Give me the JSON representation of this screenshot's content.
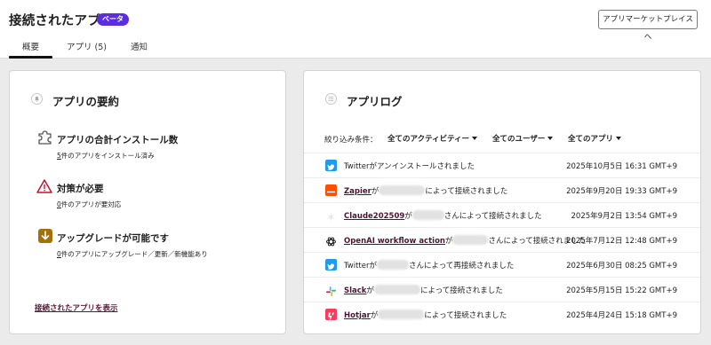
{
  "header": {
    "title": "接続されたアプリ",
    "badge": "ベータ",
    "marketplace_button": "アプリマーケットプレイスへ"
  },
  "tabs": [
    {
      "label": "概要",
      "active": true
    },
    {
      "label": "アプリ (5)",
      "active": false
    },
    {
      "label": "通知",
      "active": false
    }
  ],
  "summary": {
    "title": "アプリの要約",
    "items": [
      {
        "icon": "puzzle-icon",
        "title": "アプリの合計インストール数",
        "count": "5",
        "desc": "件のアプリをインストール済み"
      },
      {
        "icon": "warning-icon",
        "title": "対策が必要",
        "count": "0",
        "desc": "件のアプリが要対応"
      },
      {
        "icon": "download-icon",
        "title": "アップグレードが可能です",
        "count": "0",
        "desc": "件のアプリにアップグレード／更新／新機能あり"
      }
    ],
    "view_link": "接続されたアプリを表示"
  },
  "log": {
    "title": "アプリログ",
    "filter_label": "絞り込み条件：",
    "filters": [
      "全てのアクティビティー",
      "全てのユーザー",
      "全てのアプリ"
    ],
    "rows": [
      {
        "icon": "twitter-icon",
        "app": "",
        "pre": "Twitterがアンインストールされました",
        "post": "",
        "time": "2025年10月5日 16:31 GMT+9"
      },
      {
        "icon": "zapier-icon",
        "app": "Zapier",
        "pre": "が",
        "post": "によって接続されました",
        "time": "2025年9月20日 19:33 GMT+9"
      },
      {
        "icon": "claude-icon",
        "app": "Claude202509",
        "pre": "が",
        "post": "さんによって接続されました",
        "time": "2025年9月2日 13:54 GMT+9"
      },
      {
        "icon": "openai-icon",
        "app": "OpenAI workflow action",
        "pre": "が",
        "post": "さんによって接続されました",
        "time": "2025年7月12日 12:48 GMT+9"
      },
      {
        "icon": "twitter-icon",
        "app": "",
        "pre": "Twitterが",
        "post": "さんによって再接続されました",
        "time": "2025年6月30日 08:25 GMT+9"
      },
      {
        "icon": "slack-icon",
        "app": "Slack",
        "pre": "が",
        "post": "によって接続されました",
        "time": "2025年5月15日 15:22 GMT+9"
      },
      {
        "icon": "hotjar-icon",
        "app": "Hotjar",
        "pre": "が",
        "post": "によって接続されました",
        "time": "2025年4月24日 15:18 GMT+9"
      }
    ]
  },
  "colors": {
    "badge": "#5a2ee0",
    "link": "#5a1838",
    "twitter": "#1d9bf0",
    "zapier": "#ff4f00",
    "hotjar": "#fd3a5c",
    "warning": "#c0152f",
    "upgrade": "#a3700b"
  }
}
